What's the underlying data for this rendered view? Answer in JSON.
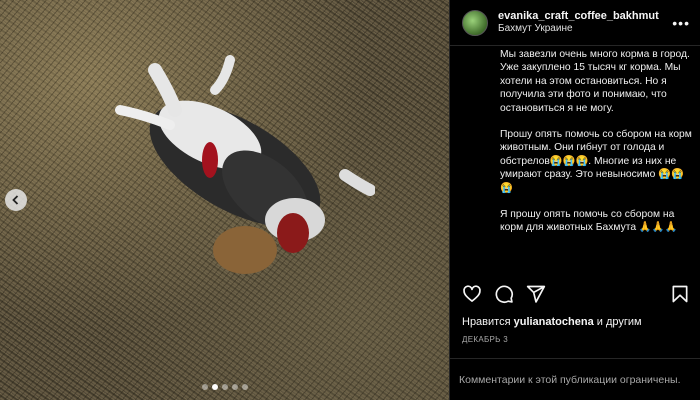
{
  "post": {
    "username": "evanika_craft_coffee_bakhmut",
    "location": "Бахмут Украине",
    "caption": [
      "Мы завезли очень много корма в город. Уже закуплено 15 тысяч кг корма. Мы хотели на этом остановиться. Но я получила эти фото и понимаю, что остановиться я не могу.",
      "Прошу опять помочь со сбором на корм животным. Они гибнут от голода и обстрелов😭😭😭. Многие из них не умирают сразу. Это невыносимо 😭😭😭",
      "Я прошу опять помочь со сбором на корм для животных Бахмута 🙏🙏🙏"
    ],
    "likes": {
      "prefix": "Нравится",
      "user": "yulianatochena",
      "suffix": "и другим"
    },
    "date": "ДЕКАБРЬ 3",
    "comments_notice": "Комментарии к этой публикации ограничены."
  },
  "icons": {
    "like": "heart-icon",
    "comment": "comment-icon",
    "share": "share-icon",
    "save": "bookmark-icon",
    "more": "more-options-icon",
    "prev": "chevron-left-icon"
  },
  "carousel": {
    "count": 5,
    "active": 1
  }
}
